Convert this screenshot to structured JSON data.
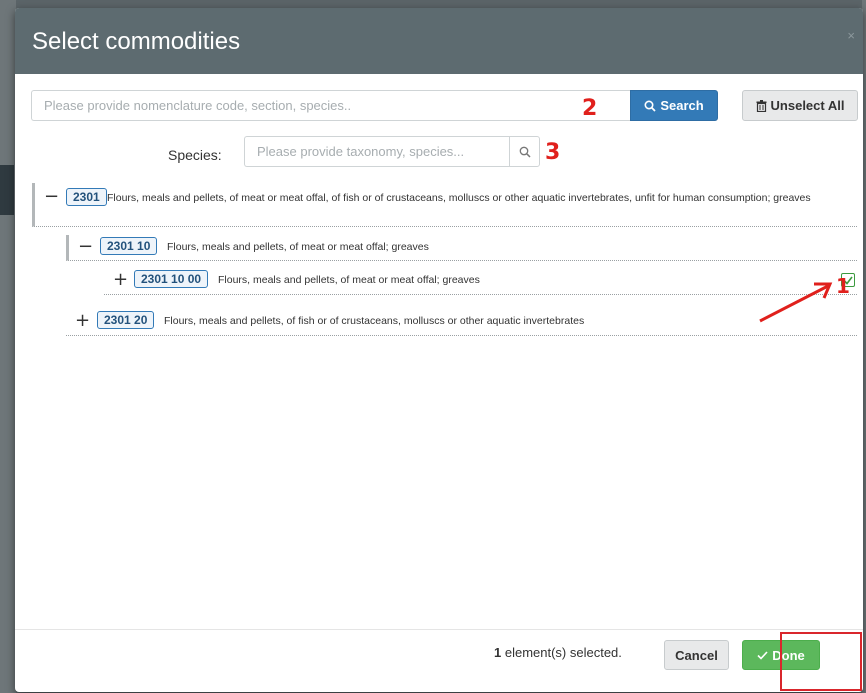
{
  "modal": {
    "title": "Select commodities",
    "close_label": "×"
  },
  "search": {
    "placeholder": "Please provide nomenclature code, section, species..",
    "search_label": "Search",
    "unselect_label": "Unselect All"
  },
  "species": {
    "label": "Species:",
    "placeholder": "Please provide taxonomy, species..."
  },
  "tree": [
    {
      "toggle": "−",
      "code": "2301",
      "description": "Flours, meals and pellets, of meat or meat offal, of fish or of crustaceans, molluscs or other aquatic invertebrates, unfit for human consumption; greaves"
    },
    {
      "toggle": "−",
      "code": "2301 10",
      "description": "Flours, meals and pellets, of meat or meat offal; greaves"
    },
    {
      "toggle": "+",
      "code": "2301 10 00",
      "description": "Flours, meals and pellets, of meat or meat offal; greaves",
      "checked": true
    },
    {
      "toggle": "+",
      "code": "2301 20",
      "description": "Flours, meals and pellets, of fish or of crustaceans, molluscs or other aquatic invertebrates"
    }
  ],
  "footer": {
    "selected_count": "1",
    "selected_suffix": " element(s) selected.",
    "cancel_label": "Cancel",
    "done_label": "Done"
  },
  "annotations": {
    "one": "1",
    "two": "2",
    "three": "3"
  },
  "colors": {
    "header_bg": "#5d6b70",
    "primary": "#337ab7",
    "success": "#5cb85c",
    "annotation_red": "#e0201c"
  },
  "icons": {
    "search": "search-icon",
    "trash": "trash-icon",
    "check": "check-icon"
  }
}
